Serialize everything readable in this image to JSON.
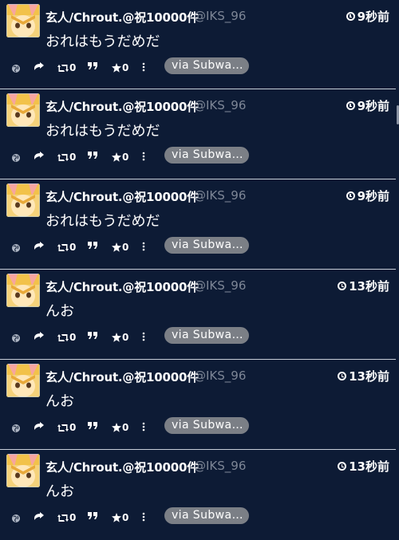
{
  "colors": {
    "background": "#0d1b35",
    "divider": "#c8ced8",
    "via_badge": "#7b7f86",
    "screen_name": "#7d8696"
  },
  "icons": {
    "globe": "globe-icon",
    "reply": "reply-icon",
    "retweet": "retweet-icon",
    "quote": "quote-icon",
    "favorite": "star-icon",
    "more": "more-vertical-icon",
    "clock": "clock-icon"
  },
  "tweets": [
    {
      "name": "玄人/Chrout.@祝10000件",
      "screen_name": "@IKS_96",
      "time": "9秒前",
      "text": "おれはもうだめだ",
      "retweets": "0",
      "favorites": "0",
      "via": "via Subwa…"
    },
    {
      "name": "玄人/Chrout.@祝10000件",
      "screen_name": "@IKS_96",
      "time": "9秒前",
      "text": "おれはもうだめだ",
      "retweets": "0",
      "favorites": "0",
      "via": "via Subwa…"
    },
    {
      "name": "玄人/Chrout.@祝10000件",
      "screen_name": "@IKS_96",
      "time": "9秒前",
      "text": "おれはもうだめだ",
      "retweets": "0",
      "favorites": "0",
      "via": "via Subwa…"
    },
    {
      "name": "玄人/Chrout.@祝10000件",
      "screen_name": "@IKS_96",
      "time": "13秒前",
      "text": "んお",
      "retweets": "0",
      "favorites": "0",
      "via": "via Subwa…"
    },
    {
      "name": "玄人/Chrout.@祝10000件",
      "screen_name": "@IKS_96",
      "time": "13秒前",
      "text": "んお",
      "retweets": "0",
      "favorites": "0",
      "via": "via Subwa…"
    },
    {
      "name": "玄人/Chrout.@祝10000件",
      "screen_name": "@IKS_96",
      "time": "13秒前",
      "text": "んお",
      "retweets": "0",
      "favorites": "0",
      "via": "via Subwa…"
    }
  ]
}
